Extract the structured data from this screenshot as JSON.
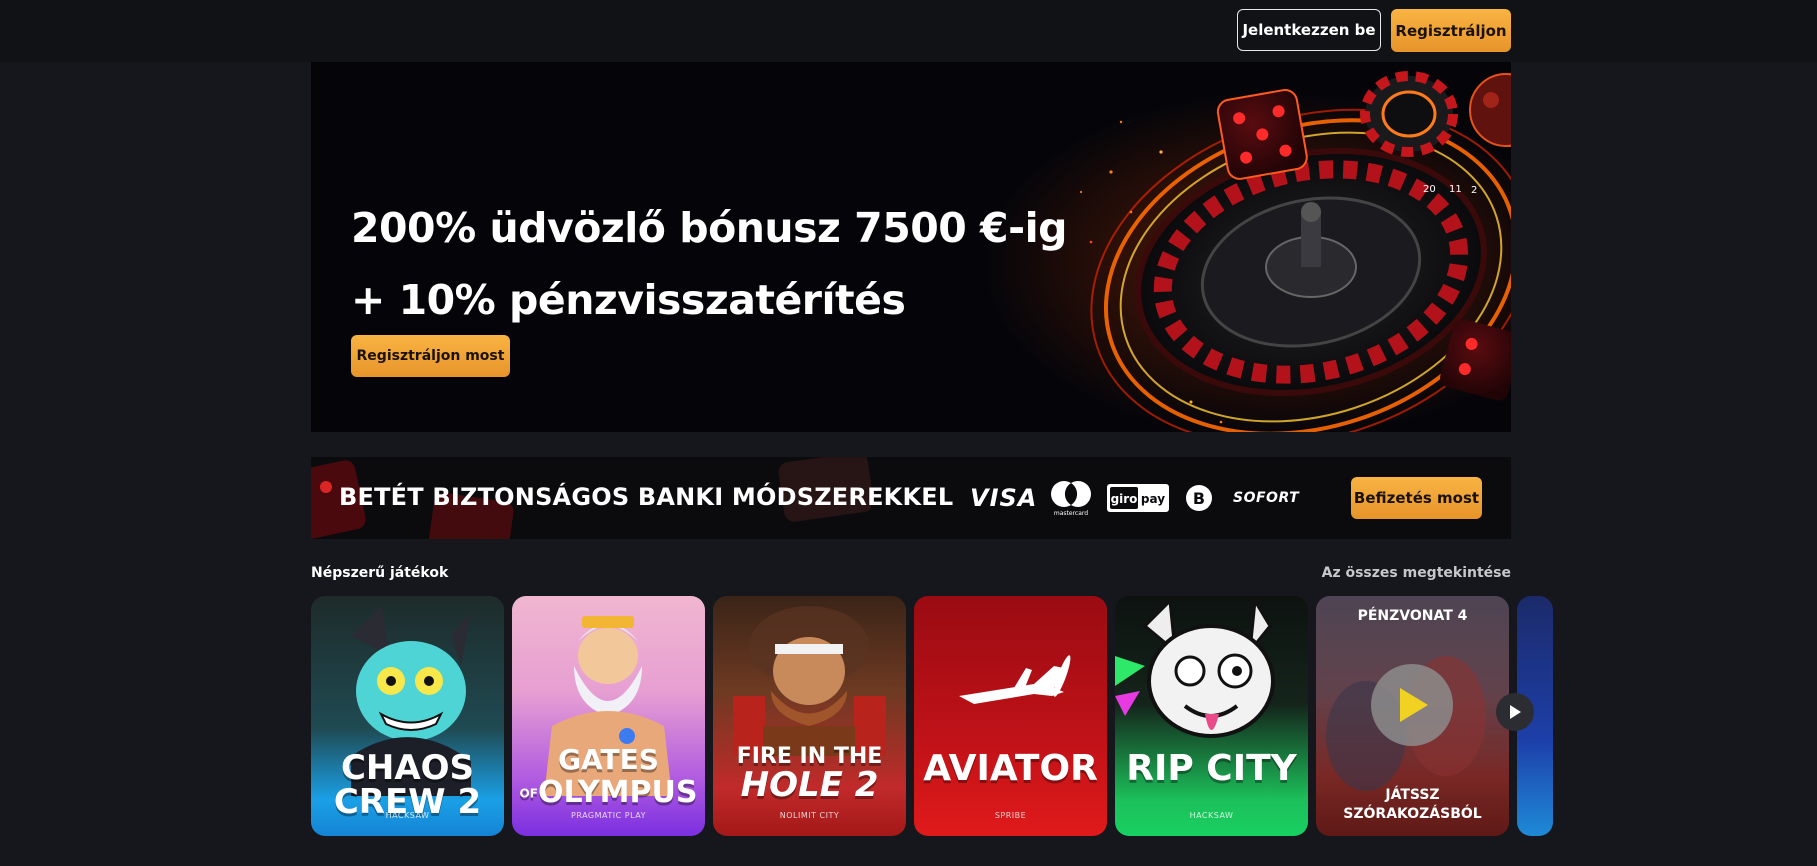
{
  "header": {
    "login_label": "Jelentkezzen be",
    "register_label": "Regisztráljon"
  },
  "hero": {
    "title_line1": "200% üdvözlő bónusz 7500 €-ig",
    "title_line2": "+ 10% pénzvisszatérítés",
    "cta_label": "Regisztráljon most",
    "roulette_numbers": [
      "20",
      "11",
      "2"
    ]
  },
  "deposit_banner": {
    "text": "BETÉT BIZTONSÁGOS BANKI MÓDSZEREKKEL",
    "payment_methods": {
      "visa": "VISA",
      "mastercard": "mastercard",
      "giropay_a": "giro",
      "giropay_b": "pay",
      "bitcoin": "B",
      "sofort": "SOFORT"
    },
    "cta_label": "Befizetés most"
  },
  "popular_games": {
    "title": "Népszerű játékok",
    "view_all_label": "Az összes megtekintése",
    "games": [
      {
        "title": "CHAOS CREW 2",
        "provider": "HACKSAW"
      },
      {
        "title_line1": "GATES",
        "title_small": "OF",
        "title_line2": "OLYMPUS",
        "provider": "PRAGMATIC PLAY"
      },
      {
        "title_line1": "FIRE IN THE",
        "title_line2": "HOLE 2",
        "provider": "NOLIMIT CITY"
      },
      {
        "title": "AVIATOR",
        "provider": "SPRIBE"
      },
      {
        "title": "RIP CITY",
        "provider": "HACKSAW"
      },
      {
        "top_label": "PÉNZVONAT 4",
        "play_label_line1": "JÁTSSZ",
        "play_label_line2": "SZÓRAKOZÁSBÓL"
      }
    ]
  },
  "colors": {
    "accent": "#f5a93b",
    "background": "#16171c",
    "topbar": "#111216"
  }
}
